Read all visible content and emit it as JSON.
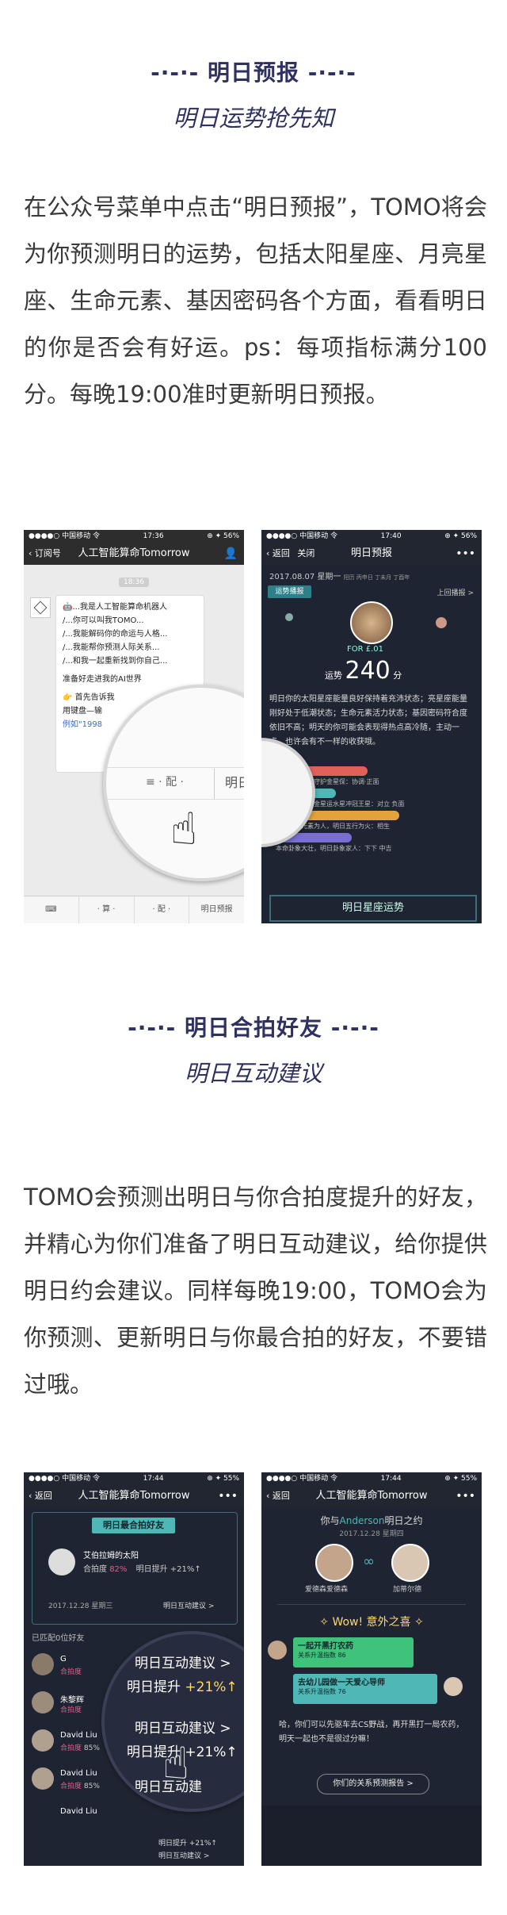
{
  "section1": {
    "title": "-·-·- 明日预报 -·-·-",
    "subtitle": "明日运势抢先知",
    "paragraph": "在公众号菜单中点击“明日预报”，TOMO将会为你预测明日的运势，包括太阳星座、月亮星座、生命元素、基因密码各个方面，看看明日的你是否会有好运。ps：每项指标满分100分。每晚19:00准时更新明日预报。"
  },
  "section2": {
    "title": "-·-·- 明日合拍好友 -·-·-",
    "subtitle": "明日互动建议",
    "paragraph": "TOMO会预测出明日与你合拍度提升的好友，并精心为你们准备了明日互动建议，给你提供明日约会建议。同样每晚19:00，TOMO会为你预测、更新明日与你最合拍的好友，不要错过哦。"
  },
  "shot1": {
    "status_left": "●●●●○ 中国移动 令",
    "time": "17:36",
    "status_right": "⊕ ✦ 56%",
    "back": "订阅号",
    "title": "人工智能算命Tomorrow",
    "timestamp": "18:36",
    "bubble_lines": [
      "🤖...我是人工智能算命机器人",
      "/...你可以叫我TOMO...",
      "/...我能解码你的命运与人格...",
      "/...我能帮你预测人际关系...",
      "/...和我一起重新找到你自己...",
      "准备好走进我的AI世界",
      "👉 首先告诉我",
      "用键盘—输",
      "例如\"1998"
    ],
    "magnifier_left": "≡ · 配 ·",
    "magnifier_right": "明日预报",
    "bottom_items": [
      "⌨",
      "· 算 ·",
      "· 配 ·",
      "明日预报"
    ]
  },
  "shot2": {
    "status_left": "●●●●○ 中国移动 令",
    "time": "17:40",
    "status_right": "⊕ ✦ 56%",
    "back": "返回",
    "close": "关闭",
    "title": "明日预报",
    "more": "•••",
    "date": "2017.08.07  星期一",
    "date_extra": "阳历 丙申日 丁未月 丁酉年",
    "badge": "运势播报",
    "prev": "上回播报 >",
    "for_label": "FOR £.01",
    "score_label": "运势",
    "score": "240",
    "score_unit": "分",
    "description": "明日你的太阳星座能量良好保持着充沛状态；亮星座能量刚好处于低潮状态；生命元素活力状态；基因密码符合度依旧不高；明天的你可能会表现得热点高冷随，主动一点，也许会有不一样的收获哦。",
    "bars": [
      "水星六合丰丰守护金星保：协调·正面",
      "月亮星座守护金星运水星冲冠王星：对立 负面",
      "你的生命元素为人，明日五行为火：相生",
      "本命卦象大壮，明日卦象家人：下下 中吉"
    ],
    "footer": "明日星座运势"
  },
  "shot3": {
    "status_left": "●●●●○ 中国移动 令",
    "time": "17:44",
    "status_right": "⊕ ✦ 55%",
    "back": "返回",
    "title": "人工智能算命Tomorrow",
    "more": "•••",
    "card_title": "明日最合拍好友",
    "friend_name": "艾伯拉姆的太阳",
    "match_label": "合拍度",
    "match_value": "82%",
    "boost": "明日提升 +21%↑",
    "date": "2017.12.28  星期三",
    "advice": "明日互动建议 >",
    "list_header": "已匹配0位好友",
    "list": [
      {
        "name": "G",
        "label": "合拍度",
        "value": ""
      },
      {
        "name": "朱黎辉",
        "label": "合拍度",
        "value": ""
      },
      {
        "name": "David Liu",
        "label": "合拍度",
        "value": "85%"
      },
      {
        "name": "David Liu",
        "label": "合拍度",
        "value": "85%"
      },
      {
        "name": "David Liu",
        "label": "",
        "value": ""
      }
    ],
    "mag_lines": [
      "明日互动建议 >",
      "明日提升 +21%↑",
      "明日互动建议 >",
      "明日提升 +21%↑",
      "明日互动建",
      "明日提升 +21%↑",
      "明日互动建议 >"
    ]
  },
  "shot4": {
    "status_left": "●●●●○ 中国移动 令",
    "time": "17:44",
    "status_right": "⊕ ✦ 55%",
    "back": "返回",
    "title": "人工智能算命Tomorrow",
    "more": "•••",
    "header_pre": "你与",
    "header_name": "Anderson",
    "header_post": "明日之约",
    "date": "2017.12.28  星期四",
    "person_a": "爱德森爱德森",
    "person_b": "加蒂尔德",
    "wow": "Wow! 意外之喜",
    "bubble1_title": "一起开黑打农药",
    "bubble1_sub": "关系升温指数 86",
    "bubble2_title": "去幼儿园做一天爱心导师",
    "bubble2_sub": "关系升温指数 76",
    "bottom_text": "哈，你们可以先驱车去CS野战，再开黑打一局农药，明天一起也不是很过分嘛！",
    "button": "你们的关系预测报告 >"
  },
  "colors": {
    "title": "#2f3160",
    "dark_bg": "#1e2431",
    "accent_teal": "#4fb7b5",
    "accent_green": "#3fc27a"
  }
}
